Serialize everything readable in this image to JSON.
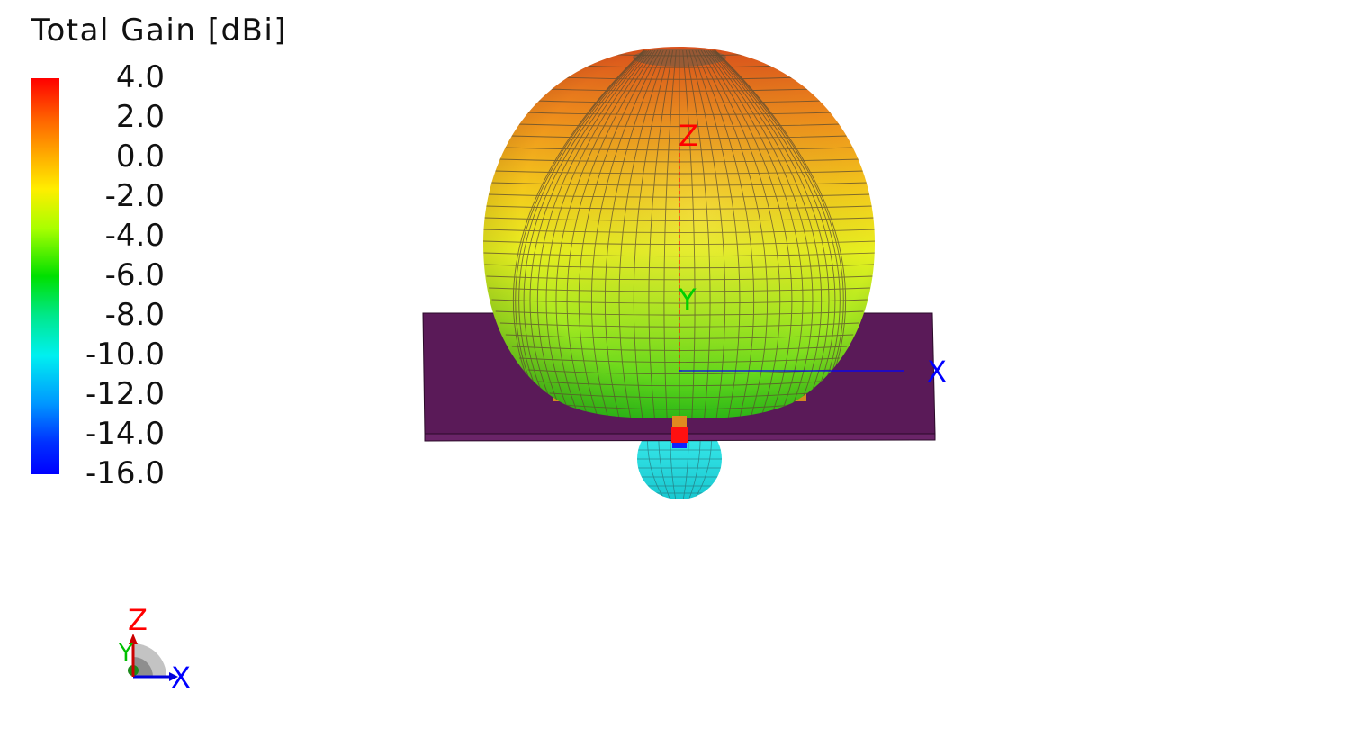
{
  "legend": {
    "title": "Total Gain [dBi]",
    "ticks": [
      "4.0",
      "2.0",
      "0.0",
      "-2.0",
      "-4.0",
      "-6.0",
      "-8.0",
      "-10.0",
      "-12.0",
      "-14.0",
      "-16.0"
    ],
    "colors": [
      "#ff0000",
      "#ff6a00",
      "#ffc800",
      "#f5ff00",
      "#a0ff00",
      "#00e000",
      "#00e890",
      "#00f0f0",
      "#00a0ff",
      "#0030ff",
      "#0000ff"
    ]
  },
  "scene": {
    "axis_labels": {
      "z": "Z",
      "y": "Y",
      "x": "X"
    },
    "axis_colors": {
      "x": "#0000ff",
      "y": "#00cc00",
      "z": "#ff0000"
    },
    "substrate_color": "#5a1a5a",
    "main_lobe_top_color": "#e0601a",
    "main_lobe_mid_color": "#e8f020",
    "main_lobe_bottom_color": "#30d000",
    "back_lobe_color": "#30e8e8"
  },
  "triad": {
    "labels": {
      "z": "Z",
      "y": "Y",
      "x": "X"
    }
  }
}
